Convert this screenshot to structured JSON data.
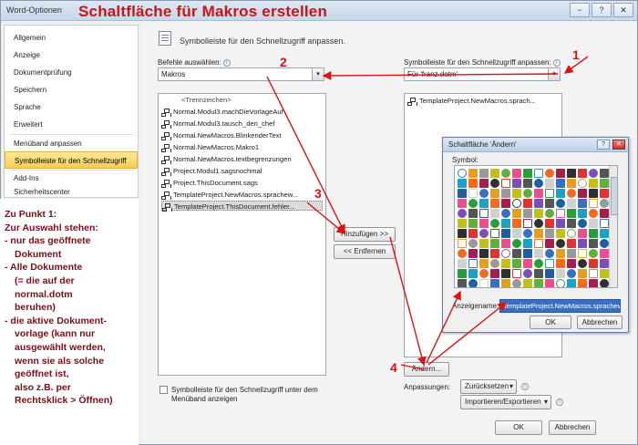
{
  "window": {
    "title": "Word-Optionen",
    "minimize_label": "−",
    "restore_label": "?",
    "close_label": "✕"
  },
  "headline": "Schaltfläche für Makros erstellen",
  "sidebar": {
    "items": [
      {
        "label": "Allgemein"
      },
      {
        "label": "Anzeige"
      },
      {
        "label": "Dokumentprüfung"
      },
      {
        "label": "Speichern"
      },
      {
        "label": "Sprache"
      },
      {
        "label": "Erweitert"
      },
      {
        "label": "Menüband anpassen"
      },
      {
        "label": "Symbolleiste für den Schnellzugriff",
        "active": true
      },
      {
        "label": "Add-Ins"
      },
      {
        "label": "Sicherheitscenter"
      }
    ]
  },
  "annotation": {
    "lines": [
      "Zu Punkt 1:",
      "Zur Auswahl stehen:",
      "- nur das geöffnete",
      "  Dokument",
      "- Alle Dokumente",
      "  (= die auf der",
      "  normal.dotm",
      "  beruhen)",
      "- die aktive Dokument-",
      "  vorlage  (kann nur",
      "  ausgewählt werden,",
      "  wenn sie als solche",
      "  geöffnet ist,",
      "  also z.B. per",
      "  Rechtsklick > Öffnen)"
    ]
  },
  "main": {
    "title": "Symbolleiste für den Schnellzugriff anpassen.",
    "commands_label": "Befehle auswählen:",
    "commands_value": "Makros",
    "toolbar_label": "Symbolleiste für den Schnellzugriff anpassen:",
    "toolbar_value": "Für 'franz.dotm'",
    "separator_item": "<Trennzeichen>",
    "commands": [
      "Normal.Modul3.machDieVorlageAuf",
      "Normal.Modul3.tausch_den_chef",
      "Normal.NewMacros.BlinkenderText",
      "Normal.NewMacros.Makro1",
      "Normal.NewMacros.textbegrenzungen",
      "Project.Modul1.sagsnochmal",
      "Project.ThisDocument.sags",
      "TemplateProject.NewMacros.sprachew...",
      "TemplateProject.ThisDocument.fehler..."
    ],
    "selected_command_index": 8,
    "toolbar_items": [
      "TemplateProject.NewMacros.sprach..."
    ],
    "add_button": "Hinzufügen >>",
    "remove_button": "<< Entfernen",
    "modify_button": "Ändern...",
    "customize_label": "Anpassungen:",
    "reset_button": "Zurücksetzen",
    "import_export_button": "Importieren/Exportieren",
    "below_ribbon_checkbox": "Symbolleiste für den Schnellzugriff unter dem Menüband anzeigen",
    "ok_button": "OK",
    "cancel_button": "Abbrechen"
  },
  "modify_dialog": {
    "title": "Schaltfläche 'Ändern'",
    "help_label": "?",
    "close_label": "✕",
    "symbol_label": "Symbol:",
    "display_name_label": "Anzeigename:",
    "display_name_value": "TemplateProject.NewMacros.sprachew",
    "ok_button": "OK",
    "cancel_button": "Abbrechen"
  },
  "markers": [
    "1",
    "2",
    "3",
    "4"
  ],
  "colors": {
    "annotation_red": "#c81414",
    "selection_gold": "#f7cd52",
    "arrow_red": "#dd1111"
  }
}
